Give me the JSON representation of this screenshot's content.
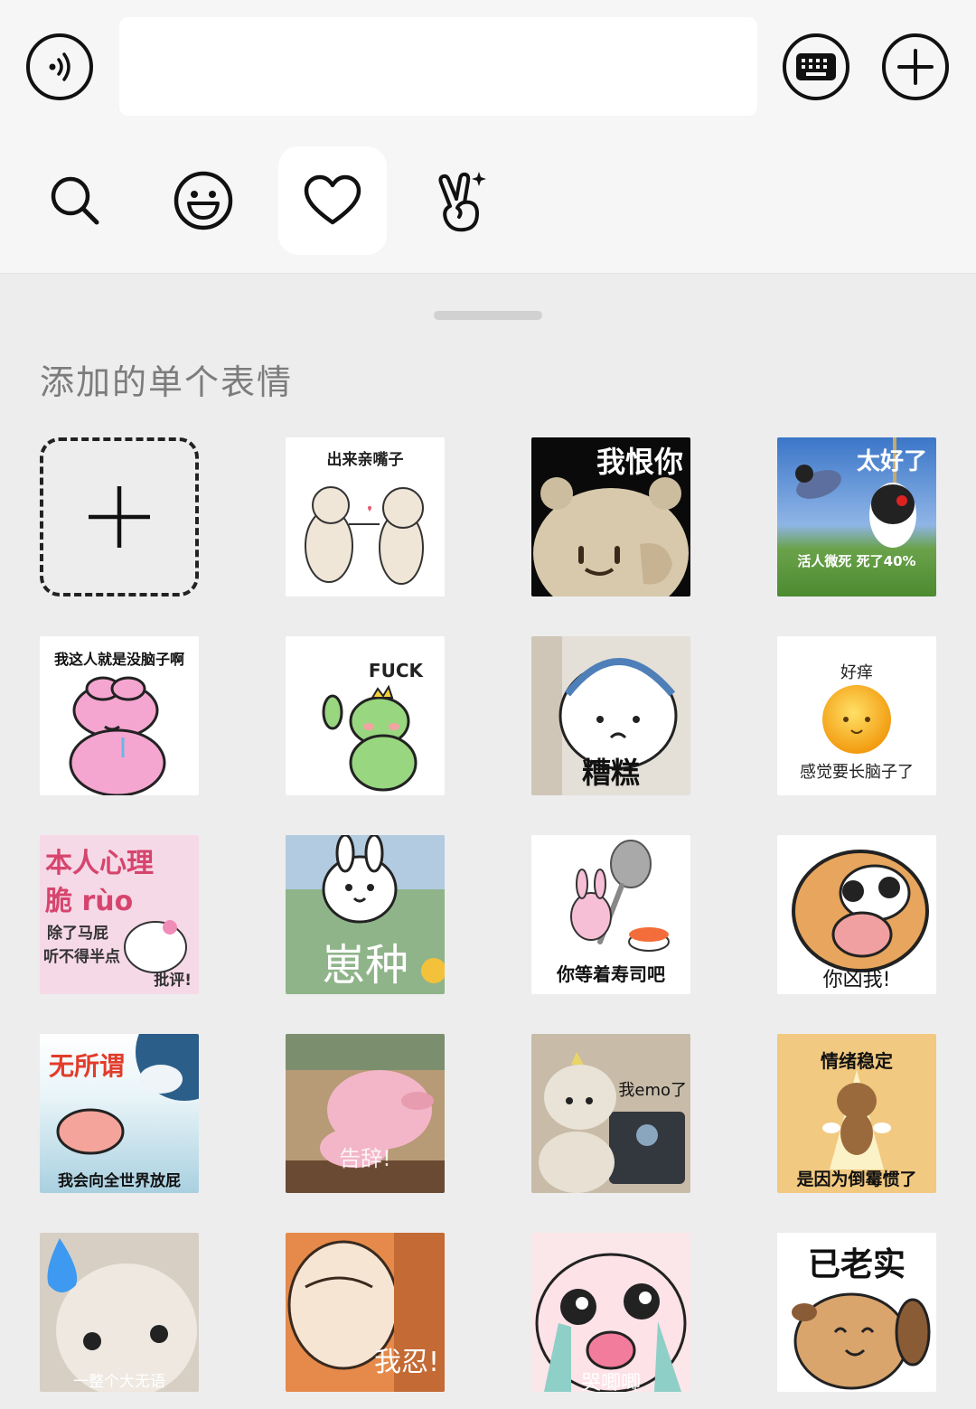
{
  "input": {
    "value": "",
    "placeholder": ""
  },
  "tabs": [
    {
      "icon": "search-icon",
      "active": false
    },
    {
      "icon": "smiley-icon",
      "active": false
    },
    {
      "icon": "heart-icon",
      "active": true
    },
    {
      "icon": "hand-gesture-icon",
      "active": false
    }
  ],
  "panel": {
    "section_title": "添加的单个表情"
  },
  "stickers": [
    {
      "caption": "出来亲嘴子"
    },
    {
      "caption": "我恨你"
    },
    {
      "caption": "太好了",
      "caption2": "活人微死 死了40%"
    },
    {
      "caption": "我这人就是没脑子啊"
    },
    {
      "caption": "FUCK"
    },
    {
      "caption": "糟糕"
    },
    {
      "caption": "好痒",
      "caption2": "感觉要长脑子了"
    },
    {
      "caption": "本人心理",
      "caption2": "脆 rùo",
      "caption3": "除了马屁",
      "caption4": "听不得半点",
      "caption5": "批评!"
    },
    {
      "caption": "崽种"
    },
    {
      "caption": "你等着寿司吧"
    },
    {
      "caption": "你凶我!"
    },
    {
      "caption": "无所谓",
      "caption2": "我会向全世界放屁"
    },
    {
      "caption": "告辞!"
    },
    {
      "caption": "我emo了"
    },
    {
      "caption": "情绪稳定",
      "caption2": "是因为倒霉惯了"
    },
    {
      "caption": "一整个大无语"
    },
    {
      "caption": "我忍!"
    },
    {
      "caption": "哭唧唧"
    },
    {
      "caption": "已老实"
    }
  ],
  "colors": {
    "accent": "#111111",
    "panel_bg": "#ededed",
    "top_bg": "#f6f6f6",
    "title": "#7c7c7c"
  }
}
